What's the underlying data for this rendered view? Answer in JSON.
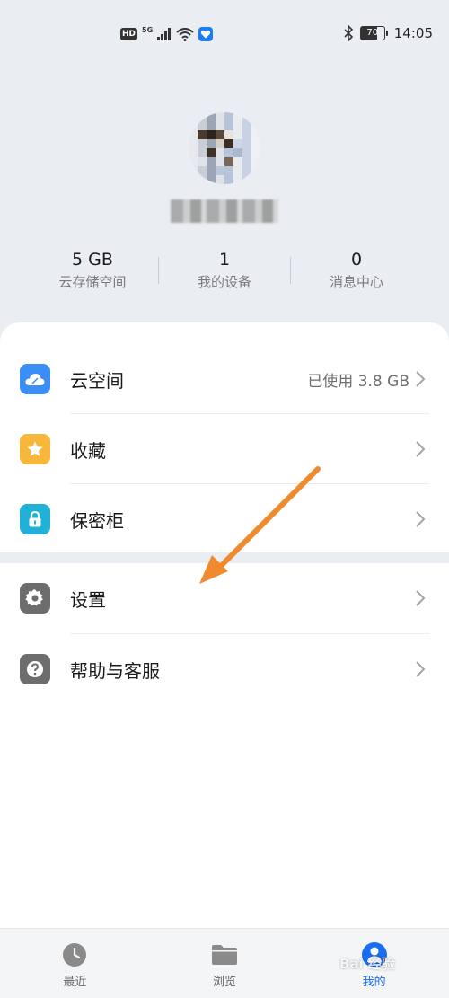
{
  "status_bar": {
    "hd": "HD",
    "network": "5G",
    "battery": "70",
    "time": "14:05"
  },
  "profile": {
    "avatar_icon": "avatar-icon"
  },
  "stats": [
    {
      "value": "5 GB",
      "label": "云存储空间"
    },
    {
      "value": "1",
      "label": "我的设备"
    },
    {
      "value": "0",
      "label": "消息中心"
    }
  ],
  "menu": {
    "cloud": {
      "label": "云空间",
      "detail": "已使用 3.8 GB",
      "color": "#3a8ef6"
    },
    "favorites": {
      "label": "收藏",
      "color": "#f7b73a"
    },
    "safe": {
      "label": "保密柜",
      "color": "#20b0d8"
    },
    "settings": {
      "label": "设置",
      "color": "#6d6d6d"
    },
    "help": {
      "label": "帮助与客服",
      "color": "#6d6d6d"
    }
  },
  "nav": [
    {
      "label": "最近",
      "icon": "clock-icon"
    },
    {
      "label": "浏览",
      "icon": "folder-icon"
    },
    {
      "label": "我的",
      "icon": "person-icon",
      "active": true
    }
  ],
  "annotation": {
    "color": "#f08a2e"
  },
  "watermark": "Bai 经验"
}
